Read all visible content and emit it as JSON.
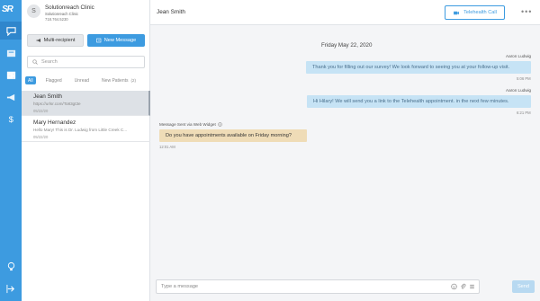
{
  "rail": {
    "logo": "SR",
    "items": [
      {
        "icon": "chat-icon",
        "active": true
      },
      {
        "icon": "inbox-icon",
        "active": false
      },
      {
        "icon": "calendar-icon",
        "active": false
      },
      {
        "icon": "video-icon",
        "active": false
      },
      {
        "icon": "megaphone-icon",
        "active": false
      },
      {
        "icon": "dollar-icon",
        "active": false
      },
      {
        "icon": "lightbulb-icon",
        "active": false
      },
      {
        "icon": "logout-icon",
        "active": false
      }
    ]
  },
  "clinic": {
    "avatar": "S",
    "name": "Solutionreach Clinic",
    "phone": "Solutionreach Clinic",
    "sub": "718.764.5230"
  },
  "actions": {
    "multi_label": "Multi-recipient",
    "new_label": "New Message"
  },
  "search": {
    "placeholder": "Search"
  },
  "filters": [
    {
      "label": "All",
      "active": true
    },
    {
      "label": "Flagged",
      "active": false
    },
    {
      "label": "Unread",
      "active": false
    },
    {
      "label": "New Patients",
      "active": false,
      "badge": "(2)"
    }
  ],
  "conversations": [
    {
      "name": "Jean Smith",
      "preview": "https://urlsr.com/To83gt3e",
      "date": "05/22/20",
      "selected": true
    },
    {
      "name": "Mary Hernandez",
      "preview": "Hello Mary! This is Dr. Ludwig from Little Creek C...",
      "date": "05/22/20",
      "selected": false
    }
  ],
  "chat": {
    "title": "Jean Smith",
    "telehealth_label": "Telehealth Call",
    "more": "•••",
    "date_header": "Friday May 22, 2020",
    "messages": [
      {
        "direction": "out",
        "sender": "Aaron Ludwig",
        "text": "Thank you for filling out our survey! We look forward to seeing you at your follow-up visit.",
        "time": "5:06 PM"
      },
      {
        "direction": "out",
        "sender": "Aaron Ludwig",
        "text": "Hi Hilary! We will send you a link to the Telehealth appointment. in the next few minutes.",
        "time": "6:21 PM"
      },
      {
        "direction": "in",
        "via": "Message Sent via Web Widget",
        "text": "Do you have appointments available on Friday morning?",
        "time": "12:01 AM"
      }
    ],
    "composer_placeholder": "Type a message",
    "send_label": "Send"
  },
  "colors": {
    "brand": "#3d9be0",
    "bubble_out": "#c6e3f5",
    "bubble_in": "#efdcb7"
  }
}
